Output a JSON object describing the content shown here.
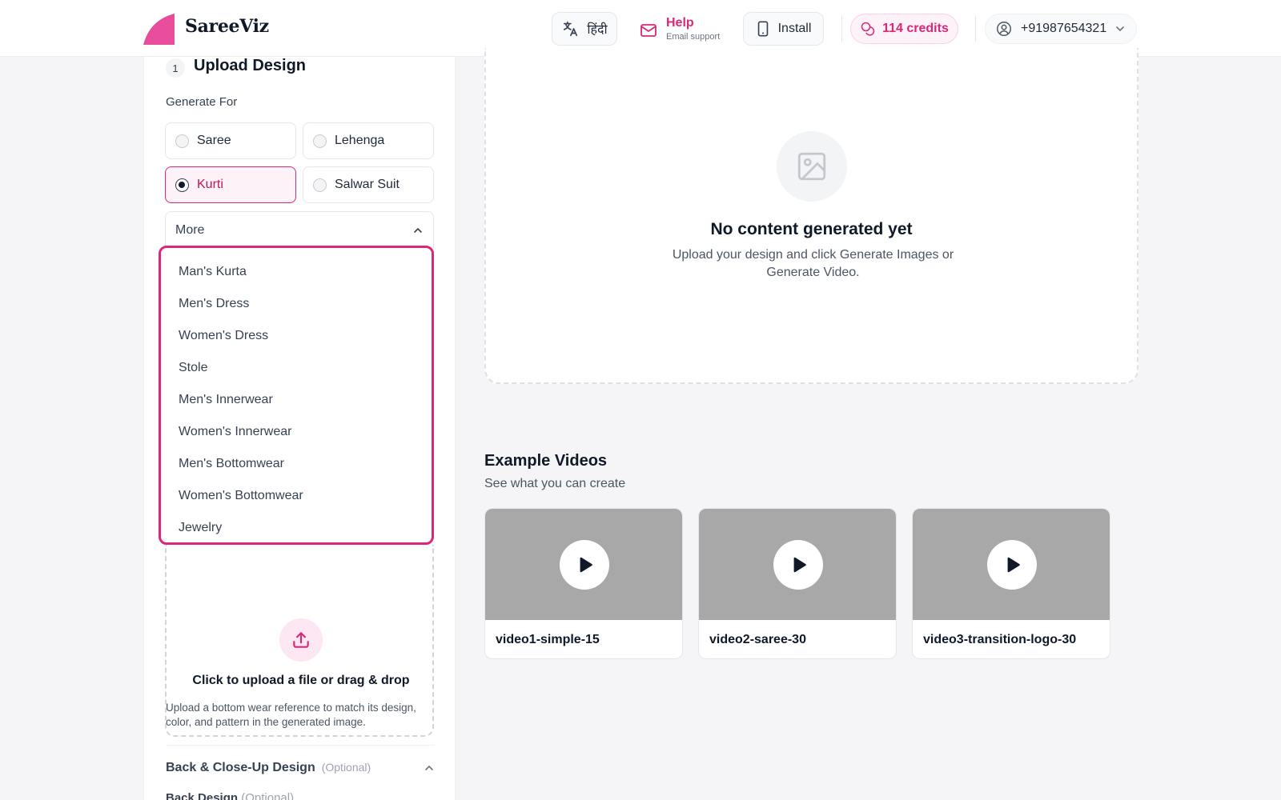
{
  "app": {
    "name": "SareeViz",
    "brand_color": "#db2777"
  },
  "header": {
    "language_label": "हिंदी",
    "help_title": "Help",
    "help_subtitle": "Email support",
    "install_label": "Install",
    "credits_label": "114 credits",
    "account_phone": "+91987654321"
  },
  "upload_panel": {
    "step_number": "1",
    "title": "Upload Design",
    "generate_for_label": "Generate For",
    "options": [
      {
        "label": "Saree",
        "selected": false
      },
      {
        "label": "Lehenga",
        "selected": false
      },
      {
        "label": "Kurti",
        "selected": true
      },
      {
        "label": "Salwar Suit",
        "selected": false
      }
    ],
    "more_label": "More",
    "more_items": [
      "Man's Kurta",
      "Men's Dress",
      "Women's Dress",
      "Stole",
      "Men's Innerwear",
      "Women's Innerwear",
      "Men's Bottomwear",
      "Women's Bottomwear",
      "Jewelry"
    ],
    "upload_text": "Click to upload a file or drag & drop",
    "upload_hint": "Upload a bottom wear reference to match its design, color, and pattern in the generated image.",
    "back_close_label": "Back & Close-Up Design",
    "optional_tag": "(Optional)",
    "back_design_label": "Back Design",
    "back_design_optional": "(Optional)"
  },
  "content": {
    "empty_title": "No content generated yet",
    "empty_subtitle": "Upload your design and click Generate Images or Generate Video."
  },
  "examples": {
    "title": "Example Videos",
    "subtitle": "See what you can create",
    "videos": [
      {
        "name": "video1-simple-15"
      },
      {
        "name": "video2-saree-30"
      },
      {
        "name": "video3-transition-logo-30"
      }
    ]
  }
}
